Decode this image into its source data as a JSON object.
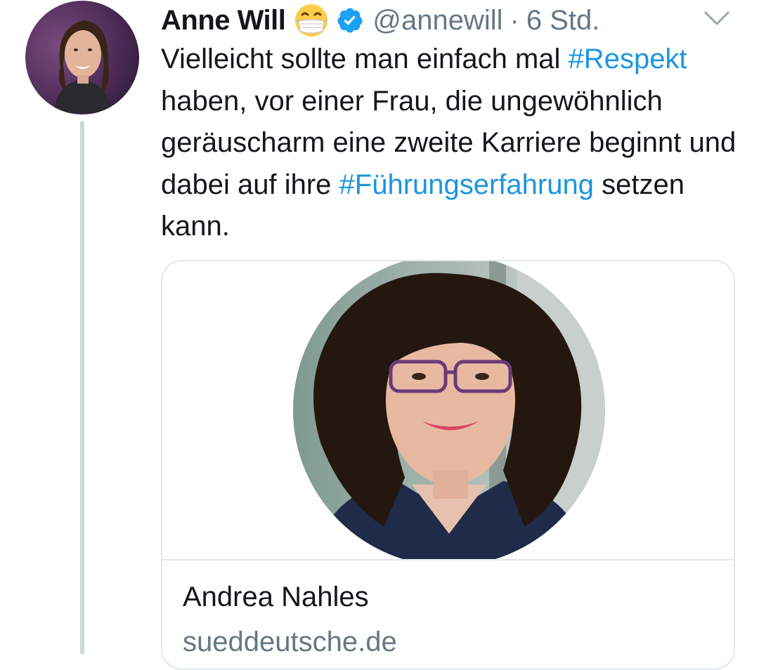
{
  "tweet": {
    "author": {
      "display_name": "Anne Will",
      "handle": "@annewill",
      "emoji_icon": "face-with-medical-mask-icon",
      "verified_icon": "verified-badge-icon"
    },
    "separator": "·",
    "timestamp": "6 Std.",
    "menu_icon": "chevron-down-icon",
    "text": {
      "part1": "Vielleicht sollte man einfach mal ",
      "hashtag1": "#Respekt",
      "part2": " haben, vor einer Frau, die ungewöhnlich geräuscharm eine zweite Karriere beginnt und dabei auf ihre ",
      "hashtag2": "#Führungserfahrung",
      "part3": " setzen kann."
    },
    "link_card": {
      "title": "Andrea Nahles",
      "domain": "sueddeutsche.de"
    }
  },
  "colors": {
    "link": "#1b95e0",
    "text": "#14171a",
    "secondary": "#657786",
    "border": "#e1e8ed",
    "thread_line": "#ccd6dd",
    "verified": "#1da1f2"
  }
}
